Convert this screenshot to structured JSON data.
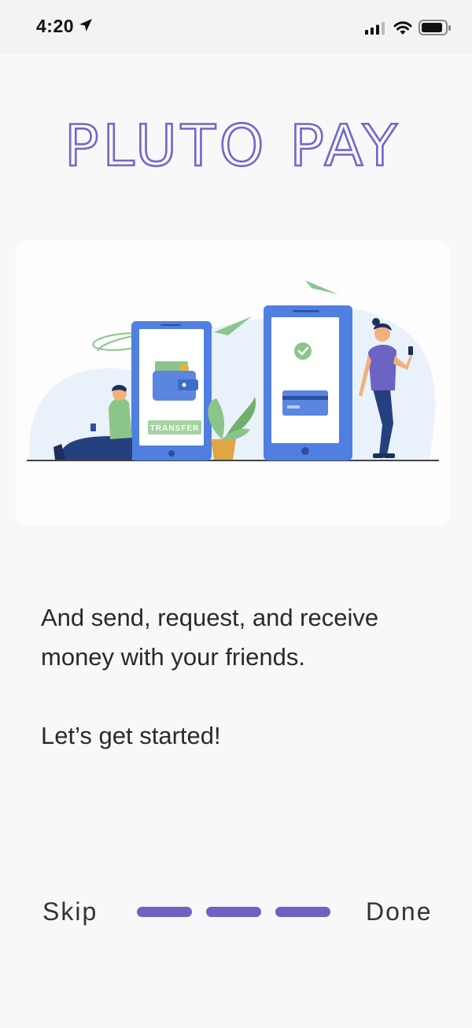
{
  "status_bar": {
    "time": "4:20",
    "icons": [
      "location-arrow-icon",
      "cellular-signal-icon",
      "wifi-icon",
      "battery-icon"
    ]
  },
  "app": {
    "logo_text": "PLUTO PAY"
  },
  "illustration": {
    "wallet_label": "TRANSFER"
  },
  "onboarding": {
    "message": "And send, request, and receive money with your friends.",
    "cta_text": "Let’s get started!"
  },
  "nav": {
    "skip_label": "Skip",
    "done_label": "Done",
    "page_count": 3
  },
  "colors": {
    "accent": "#6c63c3",
    "logo_stroke": "#6f68c9",
    "phone_blue": "#5a86e0",
    "plant_green": "#8cc58a",
    "background": "#f8f8f8"
  }
}
